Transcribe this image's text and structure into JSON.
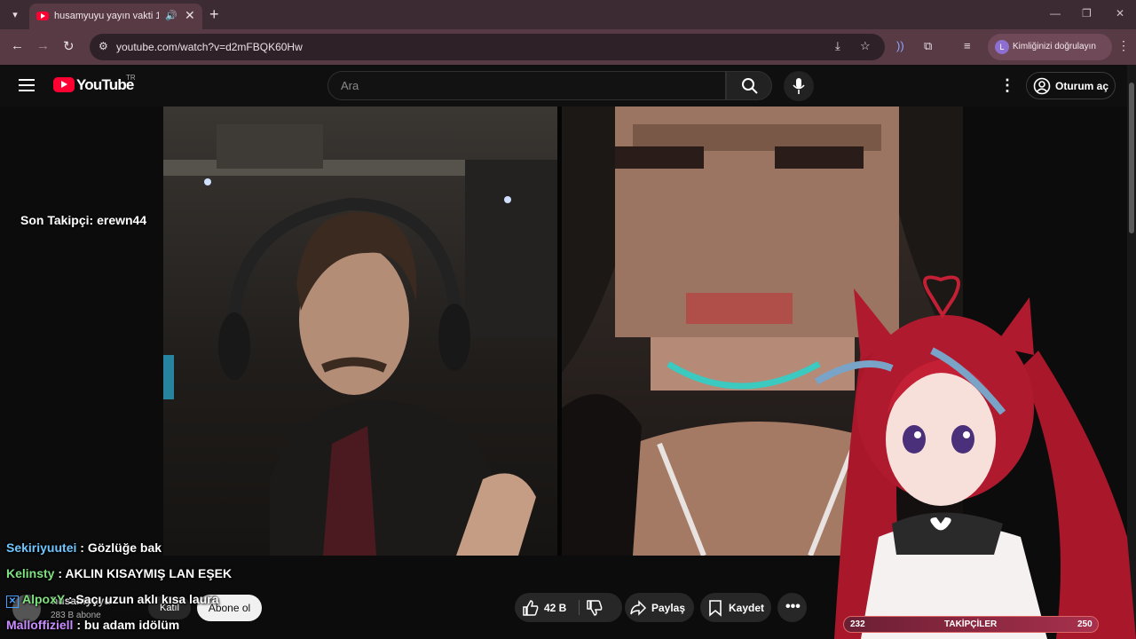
{
  "browser": {
    "tab_title": "husamyuyu yayın vakti 12 -",
    "url": "youtube.com/watch?v=d2mFBQK60Hw",
    "profile_label": "Kimliğinizi doğrulayın",
    "profile_initial": "L"
  },
  "youtube": {
    "logo_text": "YouTube",
    "region": "TR",
    "search_placeholder": "Ara",
    "signin_label": "Oturum aç"
  },
  "overlay": {
    "last_follower": "Son Takipçi: erewn44",
    "chat": [
      {
        "user": "Sekiriyuutei",
        "message": " : Gözlüğe bak",
        "color": "#6ec6ff"
      },
      {
        "user": "Kelinsty",
        "message": " : AKLIN KISAYMIŞ LAN EŞEK",
        "color": "#7ee07e"
      },
      {
        "user": "AlpoxY",
        "message": " : Saçı uzun aklı kısa laura",
        "color": "#7ee07e"
      },
      {
        "user": "Malloffiziell",
        "message": " : bu adam idölüm",
        "color": "#c98cff"
      }
    ],
    "followers_bar": {
      "label": "TAKİPÇİLER",
      "current": "232",
      "goal": "250"
    }
  },
  "video_meta": {
    "channel": "husamyuyu",
    "subscribers": "283 B abone",
    "join_label": "Katıl",
    "subscribe_label": "Abone ol",
    "likes": "42 B",
    "share_label": "Paylaş",
    "save_label": "Kaydet"
  }
}
